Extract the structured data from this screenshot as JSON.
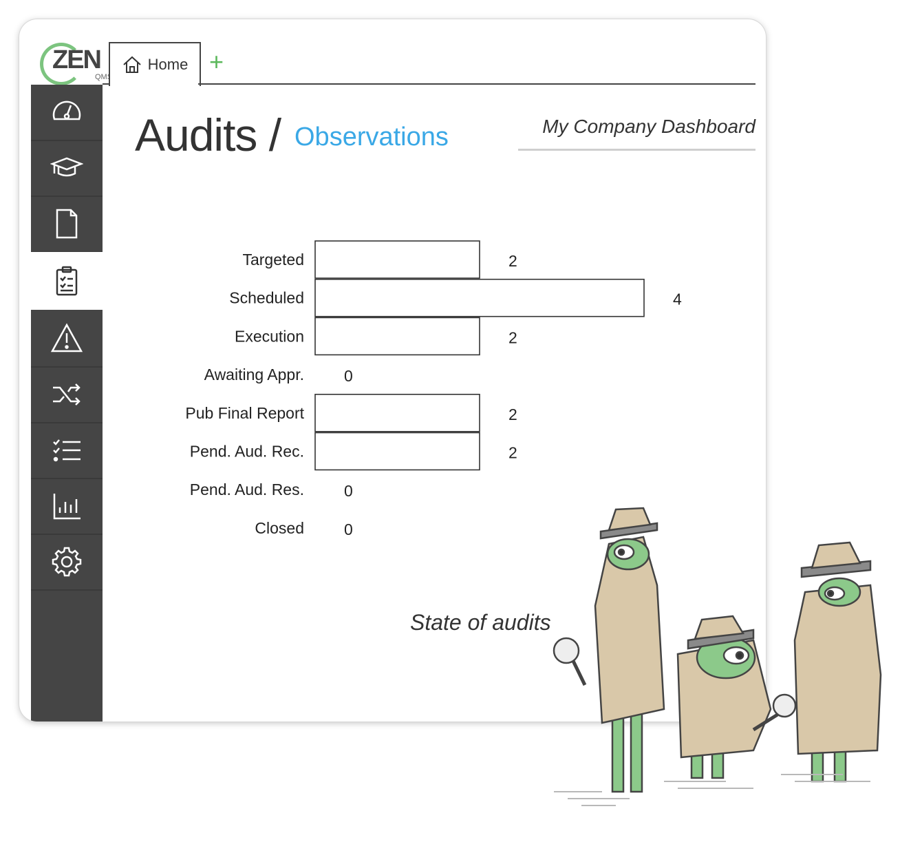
{
  "app": {
    "logo_text": "ZEN",
    "logo_sub": "QMS"
  },
  "tabs": [
    {
      "label": "Home"
    }
  ],
  "add_tab_label": "+",
  "page": {
    "title": "Audits /",
    "subtitle": "Observations",
    "dashboard_label": "My Company Dashboard"
  },
  "sidebar": {
    "items": [
      {
        "icon": "gauge-icon"
      },
      {
        "icon": "graduation-cap-icon"
      },
      {
        "icon": "document-icon"
      },
      {
        "icon": "clipboard-checklist-icon",
        "active": true
      },
      {
        "icon": "warning-icon"
      },
      {
        "icon": "shuffle-icon"
      },
      {
        "icon": "checklist-icon"
      },
      {
        "icon": "bar-chart-icon"
      },
      {
        "icon": "gear-icon"
      }
    ]
  },
  "chart_data": {
    "type": "bar",
    "orientation": "horizontal",
    "title": "State of audits",
    "categories": [
      "Targeted",
      "Scheduled",
      "Execution",
      "Awaiting Appr.",
      "Pub Final Report",
      "Pend. Aud. Rec.",
      "Pend. Aud. Res.",
      "Closed"
    ],
    "values": [
      2,
      4,
      2,
      0,
      2,
      2,
      0,
      0
    ],
    "xlim": [
      0,
      4
    ],
    "grid": false,
    "legend": "none"
  }
}
